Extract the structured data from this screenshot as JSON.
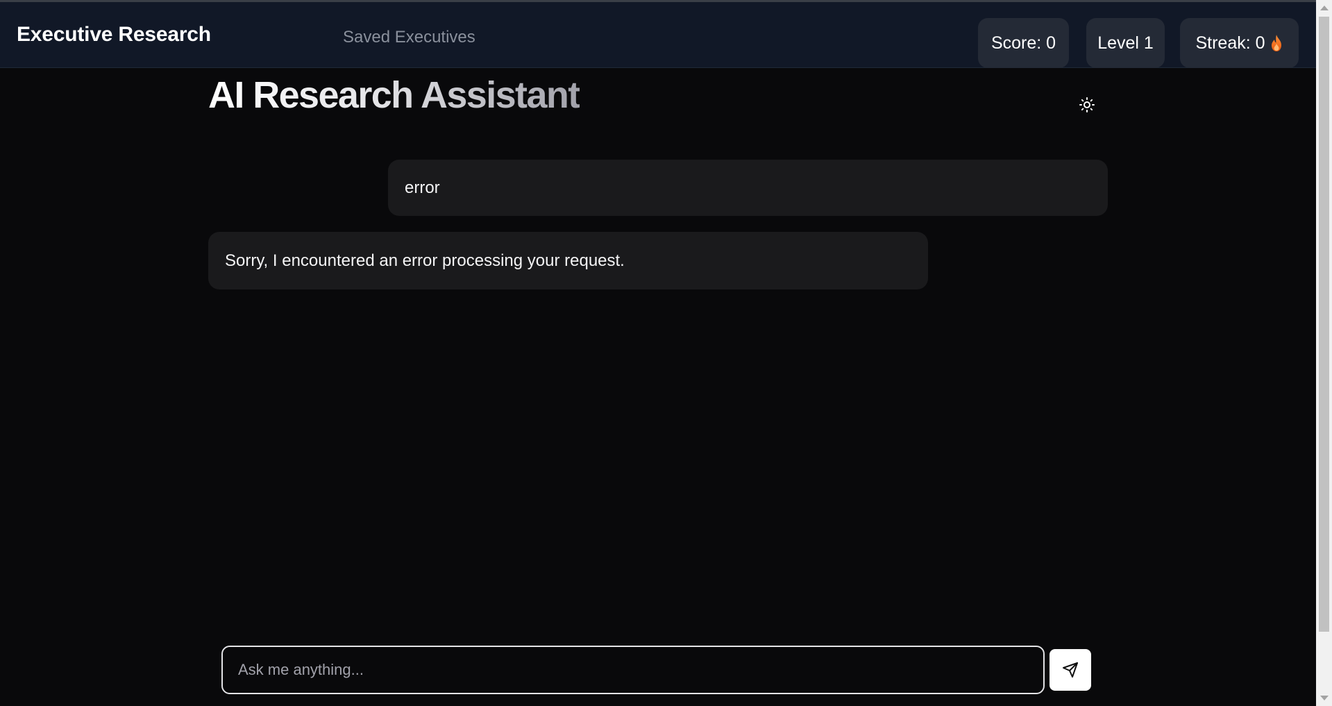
{
  "header": {
    "brand": "Executive Research",
    "nav_link": "Saved Executives",
    "stats": {
      "score": "Score: 0",
      "level": "Level 1",
      "streak": "Streak: 0"
    },
    "streak_icon": "flame-icon"
  },
  "main": {
    "title": "AI Research Assistant",
    "theme_icon": "sun-icon",
    "messages": [
      {
        "role": "user",
        "text": "error"
      },
      {
        "role": "assistant",
        "text": "Sorry, I encountered an error processing your request."
      }
    ]
  },
  "composer": {
    "placeholder": "Ask me anything...",
    "value": "",
    "send_icon": "send-icon"
  },
  "colors": {
    "background": "#09090b",
    "header_bg": "#111827",
    "stat_bg": "#242a36",
    "bubble_bg": "#1a1a1c",
    "streak_flame": "#f97316"
  }
}
